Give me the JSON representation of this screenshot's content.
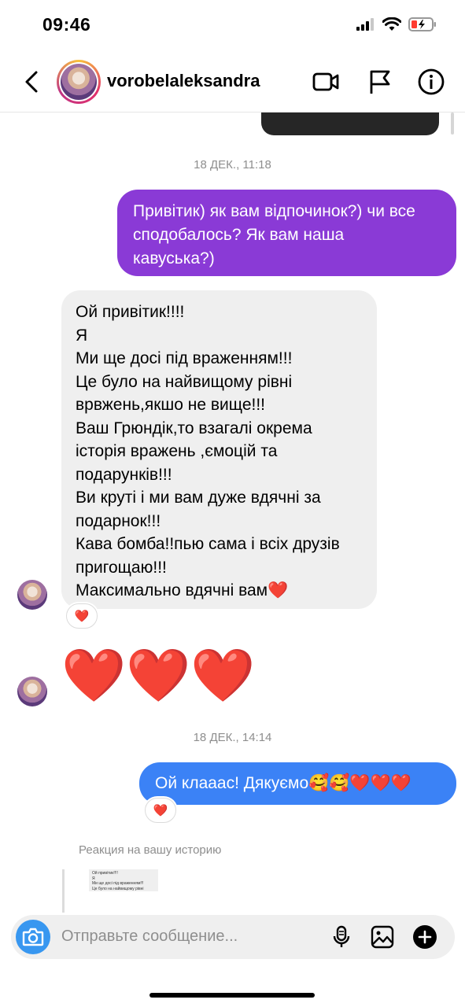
{
  "status_bar": {
    "time": "09:46"
  },
  "header": {
    "username": "vorobelaleksandra"
  },
  "messages": {
    "timestamp_1": "18 ДЕК., 11:18",
    "outgoing_1": "Привітик) як вам відпочинок?) чи все\nсподобалось? Як вам наша\nкавуська?)",
    "incoming_1": "Ой привітик!!!!\nЯ\nМи ще досі під враженням!!!\nЦе було на найвищому рівні\nврвжень,якшо не вище!!!\nВаш Грюндік,то взагалі окрема\nісторія вражень ,ємоцій та\nподарунків!!!\nВи круті і ми вам дуже вдячні за\nподарнок!!!\nКава бомба!!пью сама і всіх друзів\nпригощаю!!!\nМаксимально вдячні вам❤️",
    "reaction_1": "❤️",
    "incoming_2": "❤️❤️❤️",
    "timestamp_2": "18 ДЕК., 14:14",
    "outgoing_2": "Ой клааас! Дякуємо🥰🥰❤️❤️❤️",
    "reaction_2": "❤️",
    "story_reaction_label": "Реакция на вашу историю",
    "story_thumb_text": "Ой привітик!!!!\nЯ\nМи ще досі під враженням!!!\nЦе було на найвищому рівні"
  },
  "composer": {
    "placeholder": "Отправьте сообщение..."
  },
  "colors": {
    "outgoing_1": "#8a3ad6",
    "outgoing_2": "#3b82f6",
    "incoming": "#efefef",
    "accent": "#3897f0"
  }
}
